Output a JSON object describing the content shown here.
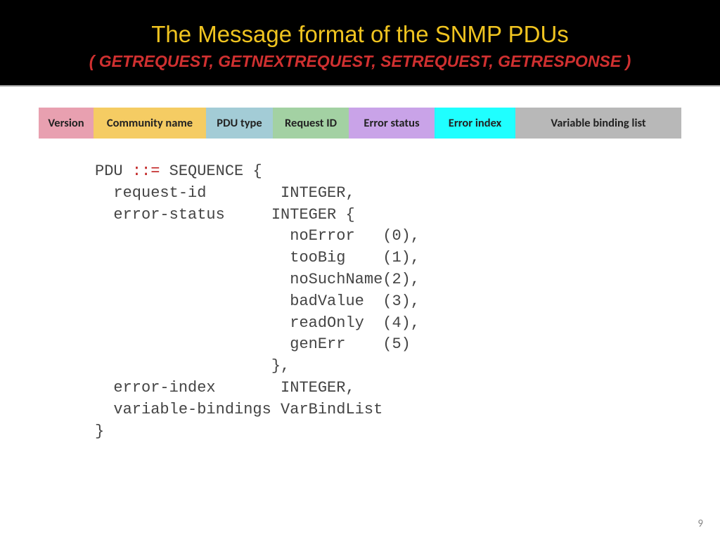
{
  "header": {
    "title": "The Message format of the SNMP PDUs",
    "subtitle": "( GETREQUEST, GETNEXTREQUEST, SETREQUEST, GETRESPONSE )"
  },
  "fields": {
    "version": "Version",
    "community": "Community name",
    "pdutype": "PDU type",
    "requestid": "Request ID",
    "errstat": "Error status",
    "erridx": "Error index",
    "varbind": "Variable binding list"
  },
  "code": {
    "l1a": "PDU ",
    "l1b": "::=",
    "l1c": " SEQUENCE {",
    "l2": "  request-id        INTEGER,",
    "l3": "  error-status     INTEGER {",
    "l4": "                     noError   (0),",
    "l5": "                     tooBig    (1),",
    "l6": "                     noSuchName(2),",
    "l7": "                     badValue  (3),",
    "l8": "                     readOnly  (4),",
    "l9": "                     genErr    (5)",
    "l10": "                   },",
    "l11": "  error-index       INTEGER,",
    "l12": "  variable-bindings VarBindList",
    "l13": "}"
  },
  "page_number": "9"
}
